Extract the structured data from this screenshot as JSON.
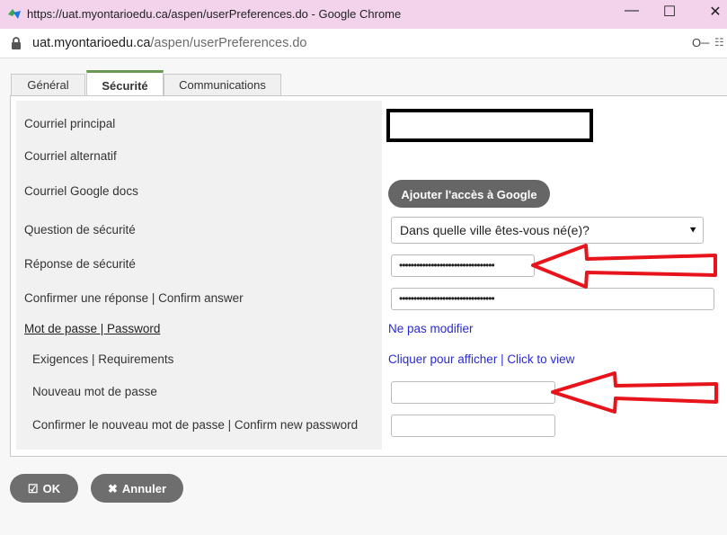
{
  "window": {
    "title": "https://uat.myontarioedu.ca/aspen/userPreferences.do - Google Chrome",
    "minimize": "—",
    "maximize": "☐",
    "close": "✕"
  },
  "address_bar": {
    "domain": "uat.myontarioedu.ca",
    "path": "/aspen/userPreferences.do"
  },
  "tabs": [
    {
      "label": "Général"
    },
    {
      "label": "Sécurité"
    },
    {
      "label": "Communications"
    }
  ],
  "form": {
    "primary_email_label": "Courriel principal",
    "alternate_email_label": "Courriel alternatif",
    "google_docs_email_label": "Courriel Google docs",
    "google_button": "Ajouter l'accès à Google",
    "security_question_label": "Question de sécurité",
    "security_question_value": "Dans quelle ville êtes-vous né(e)?",
    "security_answer_label": "Réponse de sécurité",
    "security_answer_value": "•••••••••••••••••••••••••••••••••",
    "confirm_answer_label": "Confirmer une réponse | Confirm answer",
    "confirm_answer_value": "•••••••••••••••••••••••••••••••••",
    "password_label": "Mot de passe | Password",
    "password_value_link": "Ne pas modifier",
    "requirements_label": "Exigences | Requirements",
    "requirements_link": "Cliquer pour afficher | Click to view",
    "new_password_label": "Nouveau mot de passe",
    "confirm_new_password_label": "Confirmer le nouveau mot de passe | Confirm new password"
  },
  "actions": {
    "ok_icon": "☑",
    "ok": "OK",
    "cancel_icon": "✖",
    "cancel": "Annuler"
  },
  "colors": {
    "titlebar": "#f3d3ec",
    "tab_accent": "#6a9a52",
    "arrow": "#e8141c",
    "link": "#2a2ad4",
    "button": "#6e6e6e"
  }
}
